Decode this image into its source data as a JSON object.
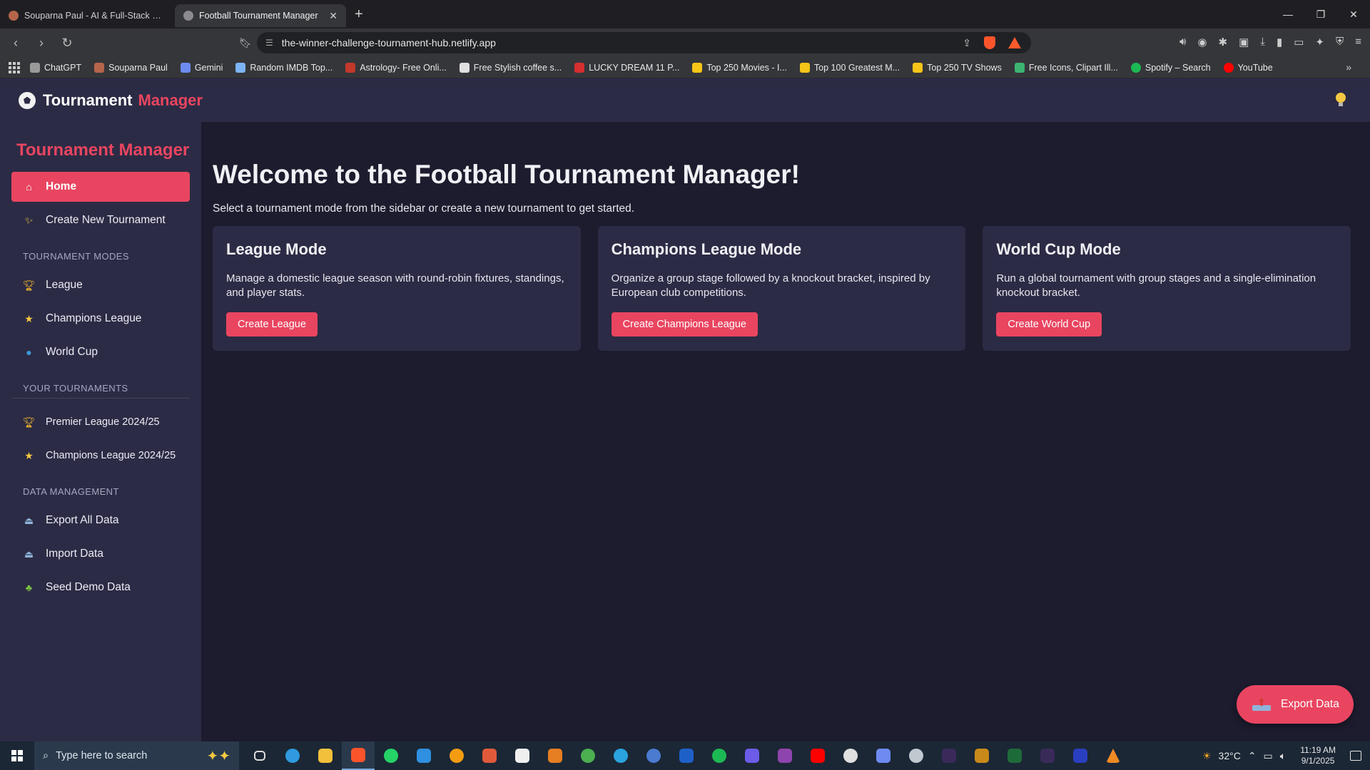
{
  "browser": {
    "tabs": [
      {
        "title": "Souparna Paul - AI & Full-Stack Deve",
        "active": false
      },
      {
        "title": "Football Tournament Manager",
        "active": true
      }
    ],
    "url": "the-winner-challenge-tournament-hub.netlify.app",
    "bookmarks": [
      {
        "label": "ChatGPT",
        "color": "#9a9a9a"
      },
      {
        "label": "Souparna Paul",
        "color": "#b5654a"
      },
      {
        "label": "Gemini",
        "color": "#6d8bf0"
      },
      {
        "label": "Random IMDB Top...",
        "color": "#7db4f5"
      },
      {
        "label": "Astrology- Free Onli...",
        "color": "#c0392b"
      },
      {
        "label": "Free Stylish coffee s...",
        "color": "#e0e0e0"
      },
      {
        "label": "LUCKY DREAM 11 P...",
        "color": "#d62f2f"
      },
      {
        "label": "Top 250 Movies - I...",
        "color": "#f5c518"
      },
      {
        "label": "Top 100 Greatest M...",
        "color": "#f5c518"
      },
      {
        "label": "Top 250 TV Shows",
        "color": "#f5c518"
      },
      {
        "label": "Free Icons, Clipart Ill...",
        "color": "#3cb371"
      },
      {
        "label": "Spotify – Search",
        "color": "#1db954"
      },
      {
        "label": "YouTube",
        "color": "#ff0000"
      }
    ]
  },
  "app": {
    "header": {
      "logo_main": "Tournament",
      "logo_accent": "Manager"
    },
    "sidebar": {
      "title": "Tournament Manager",
      "home": "Home",
      "create_new": "Create New Tournament",
      "modes_header": "TOURNAMENT MODES",
      "modes": [
        "League",
        "Champions League",
        "World Cup"
      ],
      "your_header": "YOUR TOURNAMENTS",
      "yours": [
        "Premier League 2024/25",
        "Champions League 2024/25"
      ],
      "data_header": "DATA MANAGEMENT",
      "data": [
        "Export All Data",
        "Import Data",
        "Seed Demo Data"
      ]
    },
    "main": {
      "welcome": "Welcome to the Football Tournament Manager!",
      "subtitle": "Select a tournament mode from the sidebar or create a new tournament to get started.",
      "cards": [
        {
          "title": "League Mode",
          "desc": "Manage a domestic league season with round-robin fixtures, standings, and player stats.",
          "button": "Create League"
        },
        {
          "title": "Champions League Mode",
          "desc": "Organize a group stage followed by a knockout bracket, inspired by European club competitions.",
          "button": "Create Champions League"
        },
        {
          "title": "World Cup Mode",
          "desc": "Run a global tournament with group stages and a single-elimination knockout bracket.",
          "button": "Create World Cup"
        }
      ]
    },
    "fab": {
      "label": "Export Data"
    }
  },
  "taskbar": {
    "search_placeholder": "Type here to search",
    "temperature": "32°C",
    "time": "11:19 AM",
    "date": "9/1/2025"
  },
  "colors": {
    "accent": "#e94560",
    "panel": "#2c2b45",
    "background": "#1c1c2e"
  }
}
